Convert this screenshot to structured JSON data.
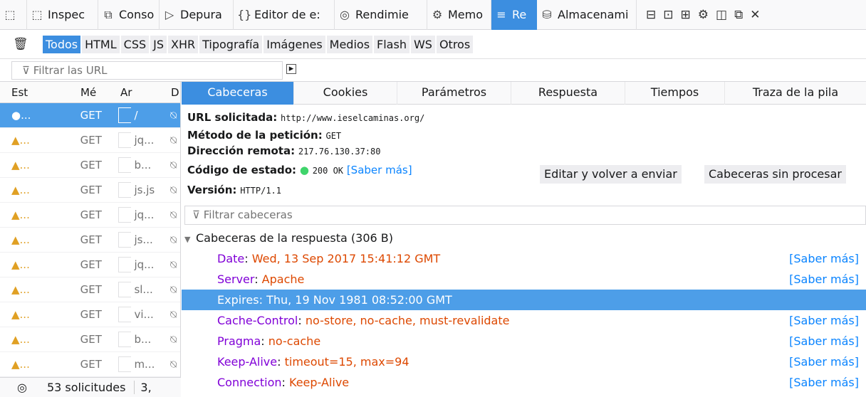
{
  "toolbar": {
    "tabs": [
      {
        "icon": "⬚",
        "label": "Inspec"
      },
      {
        "icon": "⧉",
        "label": "Conso"
      },
      {
        "icon": "▷",
        "label": "Depura"
      },
      {
        "icon": "{}",
        "label": "Editor de e:"
      },
      {
        "icon": "◎",
        "label": "Rendimie"
      },
      {
        "icon": "⚙",
        "label": "Memo"
      },
      {
        "icon": "≡",
        "label": "Re"
      },
      {
        "icon": "⛁",
        "label": "Almacenami"
      }
    ],
    "right_icons": [
      "responsive-icon",
      "split-console-icon",
      "frames-icon",
      "settings-icon",
      "dock-icon",
      "popout-icon",
      "close-icon"
    ]
  },
  "filter_types": [
    "Todos",
    "HTML",
    "CSS",
    "JS",
    "XHR",
    "Tipografía",
    "Imágenes",
    "Medios",
    "Flash",
    "WS",
    "Otros"
  ],
  "url_filter_placeholder": "Filtrar las URL",
  "request_columns": [
    "Est",
    "Mé",
    "Ar",
    "D"
  ],
  "requests": [
    {
      "status": "●...",
      "method": "GET",
      "file": "/"
    },
    {
      "status": "▲...",
      "method": "GET",
      "file": "jq..."
    },
    {
      "status": "▲...",
      "method": "GET",
      "file": "b..."
    },
    {
      "status": "▲...",
      "method": "GET",
      "file": "js.js"
    },
    {
      "status": "▲...",
      "method": "GET",
      "file": "jq..."
    },
    {
      "status": "▲...",
      "method": "GET",
      "file": "js..."
    },
    {
      "status": "▲...",
      "method": "GET",
      "file": "jq..."
    },
    {
      "status": "▲...",
      "method": "GET",
      "file": "sl..."
    },
    {
      "status": "▲...",
      "method": "GET",
      "file": "vi..."
    },
    {
      "status": "▲...",
      "method": "GET",
      "file": "b..."
    },
    {
      "status": "▲...",
      "method": "GET",
      "file": "m..."
    }
  ],
  "status_bar": {
    "count": "53 solicitudes",
    "next": "3,"
  },
  "detail_tabs": [
    "Cabeceras",
    "Cookies",
    "Parámetros",
    "Respuesta",
    "Tiempos",
    "Traza de la pila"
  ],
  "summary": {
    "url_label": "URL solicitada:",
    "url": "http://www.ieselcaminas.org/",
    "method_label": "Método de la petición:",
    "method": "GET",
    "remote_label": "Dirección remota:",
    "remote": "217.76.130.37:80",
    "status_label": "Código de estado:",
    "status_code": "200 OK",
    "learn_more": "[Saber más]",
    "version_label": "Versión:",
    "version": "HTTP/1.1"
  },
  "buttons": {
    "edit_resend": "Editar y volver a enviar",
    "raw_headers": "Cabeceras sin procesar"
  },
  "header_filter_placeholder": "Filtrar cabeceras",
  "response_section": "Cabeceras de la respuesta (306 B)",
  "headers": [
    {
      "name": "Date",
      "value": "Wed, 13 Sep 2017 15:41:12 GMT",
      "link": "[Saber más]"
    },
    {
      "name": "Server",
      "value": "Apache",
      "link": "[Saber más]"
    },
    {
      "name": "Expires",
      "value": "Thu, 19 Nov 1981 08:52:00 GMT",
      "link": ""
    },
    {
      "name": "Cache-Control",
      "value": "no-store, no-cache, must-revalidate",
      "link": "[Saber más]"
    },
    {
      "name": "Pragma",
      "value": "no-cache",
      "link": "[Saber más]"
    },
    {
      "name": "Keep-Alive",
      "value": "timeout=15, max=94",
      "link": "[Saber más]"
    },
    {
      "name": "Connection",
      "value": "Keep-Alive",
      "link": "[Saber más]"
    }
  ],
  "colors": {
    "accent": "#3c8ee0",
    "header_name": "#8000d7",
    "header_value": "#dd4800",
    "link": "#0a84ff",
    "ok": "#3fd46b",
    "warn": "#e0a024"
  }
}
